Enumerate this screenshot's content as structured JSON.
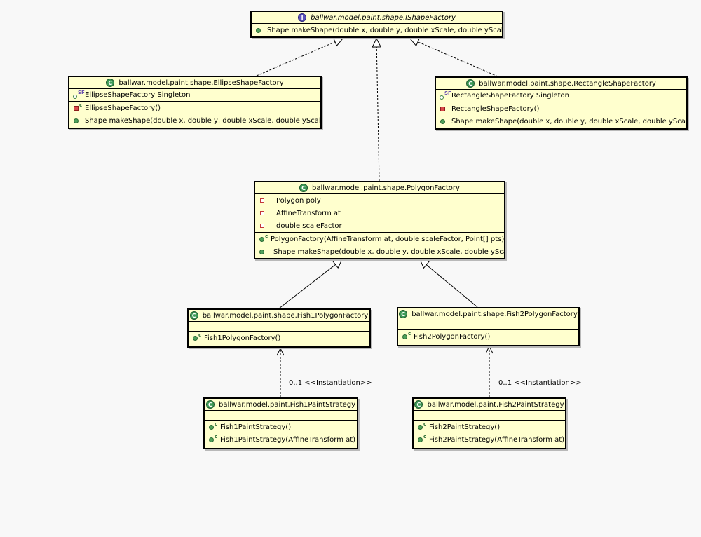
{
  "diagram": {
    "colors": {
      "box_fill": "#ffffce",
      "background": "#f8f8f8",
      "class_icon": "#3e9a57",
      "interface_icon": "#5b52b8"
    },
    "interface_ishape": {
      "title": "ballwar.model.paint.shape.IShapeFactory",
      "icon": "interface-icon",
      "methods": [
        "Shape makeShape(double x, double y, double xScale, double yScale)"
      ]
    },
    "class_ellipse": {
      "title": "ballwar.model.paint.shape.EllipseShapeFactory",
      "fields": [
        "EllipseShapeFactory Singleton"
      ],
      "constructor": "EllipseShapeFactory()",
      "methods": [
        "Shape makeShape(double x, double y, double xScale, double yScale)"
      ]
    },
    "class_rectangle": {
      "title": "ballwar.model.paint.shape.RectangleShapeFactory",
      "fields": [
        "RectangleShapeFactory Singleton"
      ],
      "constructor": "RectangleShapeFactory()",
      "methods": [
        "Shape makeShape(double x, double y, double xScale, double yScale)"
      ]
    },
    "class_polygon": {
      "title": "ballwar.model.paint.shape.PolygonFactory",
      "fields": [
        "Polygon poly",
        "AffineTransform at",
        "double scaleFactor"
      ],
      "constructor": "PolygonFactory(AffineTransform at, double scaleFactor, Point[] pts)",
      "methods": [
        "Shape makeShape(double x, double y, double xScale, double yScale)"
      ]
    },
    "class_fish1_factory": {
      "title": "ballwar.model.paint.shape.Fish1PolygonFactory",
      "constructor": "Fish1PolygonFactory()"
    },
    "class_fish2_factory": {
      "title": "ballwar.model.paint.shape.Fish2PolygonFactory",
      "constructor": "Fish2PolygonFactory()"
    },
    "class_fish1_strategy": {
      "title": "ballwar.model.paint.Fish1PaintStrategy",
      "constructors": [
        "Fish1PaintStrategy()",
        "Fish1PaintStrategy(AffineTransform at)"
      ]
    },
    "class_fish2_strategy": {
      "title": "ballwar.model.paint.Fish2PaintStrategy",
      "constructors": [
        "Fish2PaintStrategy()",
        "Fish2PaintStrategy(AffineTransform at)"
      ]
    },
    "edge_labels": {
      "fish1_instantiation": "0..1 <<Instantiation>>",
      "fish2_instantiation": "0..1 <<Instantiation>>"
    }
  }
}
